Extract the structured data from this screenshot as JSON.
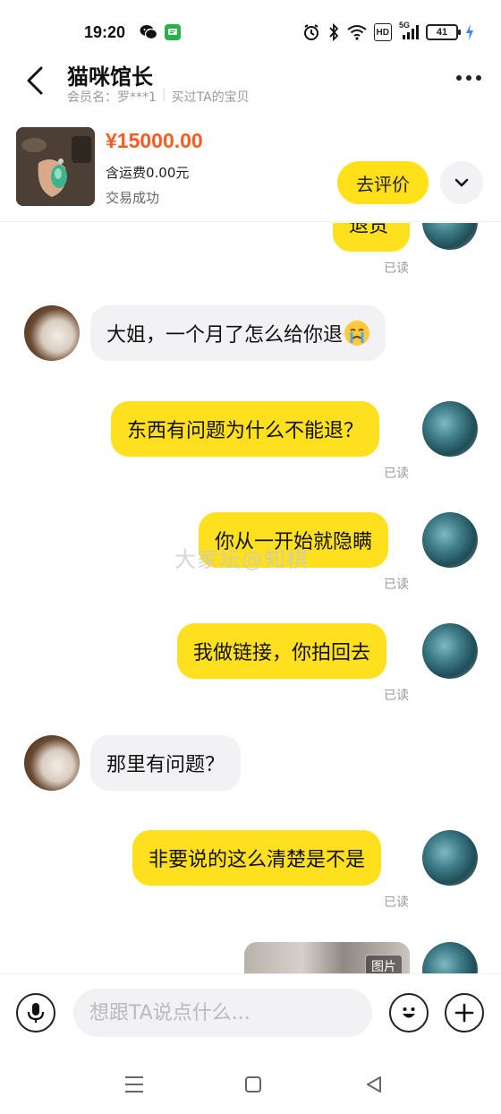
{
  "status_bar": {
    "time": "19:20",
    "battery": "41",
    "network": "5G",
    "hd": "HD"
  },
  "header": {
    "shop_name": "猫咪馆长",
    "member_name": "会员名：罗***1",
    "member_tag": "买过TA的宝贝"
  },
  "product": {
    "price": "¥15000.00",
    "shipping": "含运费0.00元",
    "status": "交易成功",
    "review_label": "去评价"
  },
  "messages": [
    {
      "sender": "me",
      "text": "退货",
      "status": "已读"
    },
    {
      "sender": "them",
      "text": "大姐，一个月了怎么给你退"
    },
    {
      "sender": "me",
      "text": "东西有问题为什么不能退？",
      "status": "已读"
    },
    {
      "sender": "me",
      "text": "你从一开始就隐瞒",
      "status": "已读"
    },
    {
      "sender": "me",
      "text": "我做链接，你拍回去",
      "status": "已读"
    },
    {
      "sender": "them",
      "text": "那里有问题？"
    },
    {
      "sender": "me",
      "text": "非要说的这么清楚是不是",
      "status": "已读"
    },
    {
      "sender": "me",
      "type": "image",
      "tag": "图片"
    }
  ],
  "watermark": "大家坛@知棋",
  "input": {
    "placeholder": "想跟TA说点什么..."
  },
  "icons": {
    "back": "back-arrow-icon",
    "more": "more-dots-icon",
    "expand": "chevron-down-icon",
    "voice": "microphone-icon",
    "emoji": "emoji-icon",
    "add": "plus-icon"
  },
  "colors": {
    "accent": "#ffe01e",
    "price": "#ff5a1f",
    "them_bubble": "#f2f2f4"
  }
}
